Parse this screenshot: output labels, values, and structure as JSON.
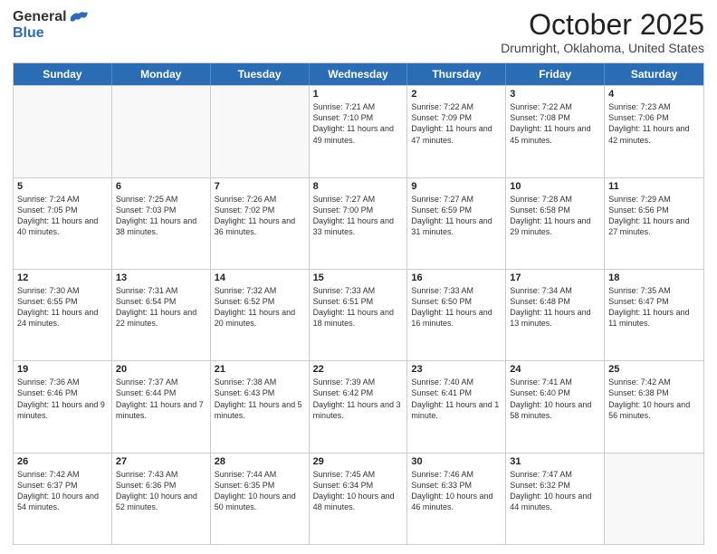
{
  "header": {
    "logo_general": "General",
    "logo_blue": "Blue",
    "title": "October 2025",
    "subtitle": "Drumright, Oklahoma, United States"
  },
  "days_of_week": [
    "Sunday",
    "Monday",
    "Tuesday",
    "Wednesday",
    "Thursday",
    "Friday",
    "Saturday"
  ],
  "weeks": [
    [
      {
        "day": "",
        "empty": true
      },
      {
        "day": "",
        "empty": true
      },
      {
        "day": "",
        "empty": true
      },
      {
        "day": "1",
        "sunrise": "Sunrise: 7:21 AM",
        "sunset": "Sunset: 7:10 PM",
        "daylight": "Daylight: 11 hours and 49 minutes."
      },
      {
        "day": "2",
        "sunrise": "Sunrise: 7:22 AM",
        "sunset": "Sunset: 7:09 PM",
        "daylight": "Daylight: 11 hours and 47 minutes."
      },
      {
        "day": "3",
        "sunrise": "Sunrise: 7:22 AM",
        "sunset": "Sunset: 7:08 PM",
        "daylight": "Daylight: 11 hours and 45 minutes."
      },
      {
        "day": "4",
        "sunrise": "Sunrise: 7:23 AM",
        "sunset": "Sunset: 7:06 PM",
        "daylight": "Daylight: 11 hours and 42 minutes."
      }
    ],
    [
      {
        "day": "5",
        "sunrise": "Sunrise: 7:24 AM",
        "sunset": "Sunset: 7:05 PM",
        "daylight": "Daylight: 11 hours and 40 minutes."
      },
      {
        "day": "6",
        "sunrise": "Sunrise: 7:25 AM",
        "sunset": "Sunset: 7:03 PM",
        "daylight": "Daylight: 11 hours and 38 minutes."
      },
      {
        "day": "7",
        "sunrise": "Sunrise: 7:26 AM",
        "sunset": "Sunset: 7:02 PM",
        "daylight": "Daylight: 11 hours and 36 minutes."
      },
      {
        "day": "8",
        "sunrise": "Sunrise: 7:27 AM",
        "sunset": "Sunset: 7:00 PM",
        "daylight": "Daylight: 11 hours and 33 minutes."
      },
      {
        "day": "9",
        "sunrise": "Sunrise: 7:27 AM",
        "sunset": "Sunset: 6:59 PM",
        "daylight": "Daylight: 11 hours and 31 minutes."
      },
      {
        "day": "10",
        "sunrise": "Sunrise: 7:28 AM",
        "sunset": "Sunset: 6:58 PM",
        "daylight": "Daylight: 11 hours and 29 minutes."
      },
      {
        "day": "11",
        "sunrise": "Sunrise: 7:29 AM",
        "sunset": "Sunset: 6:56 PM",
        "daylight": "Daylight: 11 hours and 27 minutes."
      }
    ],
    [
      {
        "day": "12",
        "sunrise": "Sunrise: 7:30 AM",
        "sunset": "Sunset: 6:55 PM",
        "daylight": "Daylight: 11 hours and 24 minutes."
      },
      {
        "day": "13",
        "sunrise": "Sunrise: 7:31 AM",
        "sunset": "Sunset: 6:54 PM",
        "daylight": "Daylight: 11 hours and 22 minutes."
      },
      {
        "day": "14",
        "sunrise": "Sunrise: 7:32 AM",
        "sunset": "Sunset: 6:52 PM",
        "daylight": "Daylight: 11 hours and 20 minutes."
      },
      {
        "day": "15",
        "sunrise": "Sunrise: 7:33 AM",
        "sunset": "Sunset: 6:51 PM",
        "daylight": "Daylight: 11 hours and 18 minutes."
      },
      {
        "day": "16",
        "sunrise": "Sunrise: 7:33 AM",
        "sunset": "Sunset: 6:50 PM",
        "daylight": "Daylight: 11 hours and 16 minutes."
      },
      {
        "day": "17",
        "sunrise": "Sunrise: 7:34 AM",
        "sunset": "Sunset: 6:48 PM",
        "daylight": "Daylight: 11 hours and 13 minutes."
      },
      {
        "day": "18",
        "sunrise": "Sunrise: 7:35 AM",
        "sunset": "Sunset: 6:47 PM",
        "daylight": "Daylight: 11 hours and 11 minutes."
      }
    ],
    [
      {
        "day": "19",
        "sunrise": "Sunrise: 7:36 AM",
        "sunset": "Sunset: 6:46 PM",
        "daylight": "Daylight: 11 hours and 9 minutes."
      },
      {
        "day": "20",
        "sunrise": "Sunrise: 7:37 AM",
        "sunset": "Sunset: 6:44 PM",
        "daylight": "Daylight: 11 hours and 7 minutes."
      },
      {
        "day": "21",
        "sunrise": "Sunrise: 7:38 AM",
        "sunset": "Sunset: 6:43 PM",
        "daylight": "Daylight: 11 hours and 5 minutes."
      },
      {
        "day": "22",
        "sunrise": "Sunrise: 7:39 AM",
        "sunset": "Sunset: 6:42 PM",
        "daylight": "Daylight: 11 hours and 3 minutes."
      },
      {
        "day": "23",
        "sunrise": "Sunrise: 7:40 AM",
        "sunset": "Sunset: 6:41 PM",
        "daylight": "Daylight: 11 hours and 1 minute."
      },
      {
        "day": "24",
        "sunrise": "Sunrise: 7:41 AM",
        "sunset": "Sunset: 6:40 PM",
        "daylight": "Daylight: 10 hours and 58 minutes."
      },
      {
        "day": "25",
        "sunrise": "Sunrise: 7:42 AM",
        "sunset": "Sunset: 6:38 PM",
        "daylight": "Daylight: 10 hours and 56 minutes."
      }
    ],
    [
      {
        "day": "26",
        "sunrise": "Sunrise: 7:42 AM",
        "sunset": "Sunset: 6:37 PM",
        "daylight": "Daylight: 10 hours and 54 minutes."
      },
      {
        "day": "27",
        "sunrise": "Sunrise: 7:43 AM",
        "sunset": "Sunset: 6:36 PM",
        "daylight": "Daylight: 10 hours and 52 minutes."
      },
      {
        "day": "28",
        "sunrise": "Sunrise: 7:44 AM",
        "sunset": "Sunset: 6:35 PM",
        "daylight": "Daylight: 10 hours and 50 minutes."
      },
      {
        "day": "29",
        "sunrise": "Sunrise: 7:45 AM",
        "sunset": "Sunset: 6:34 PM",
        "daylight": "Daylight: 10 hours and 48 minutes."
      },
      {
        "day": "30",
        "sunrise": "Sunrise: 7:46 AM",
        "sunset": "Sunset: 6:33 PM",
        "daylight": "Daylight: 10 hours and 46 minutes."
      },
      {
        "day": "31",
        "sunrise": "Sunrise: 7:47 AM",
        "sunset": "Sunset: 6:32 PM",
        "daylight": "Daylight: 10 hours and 44 minutes."
      },
      {
        "day": "",
        "empty": true
      }
    ]
  ]
}
